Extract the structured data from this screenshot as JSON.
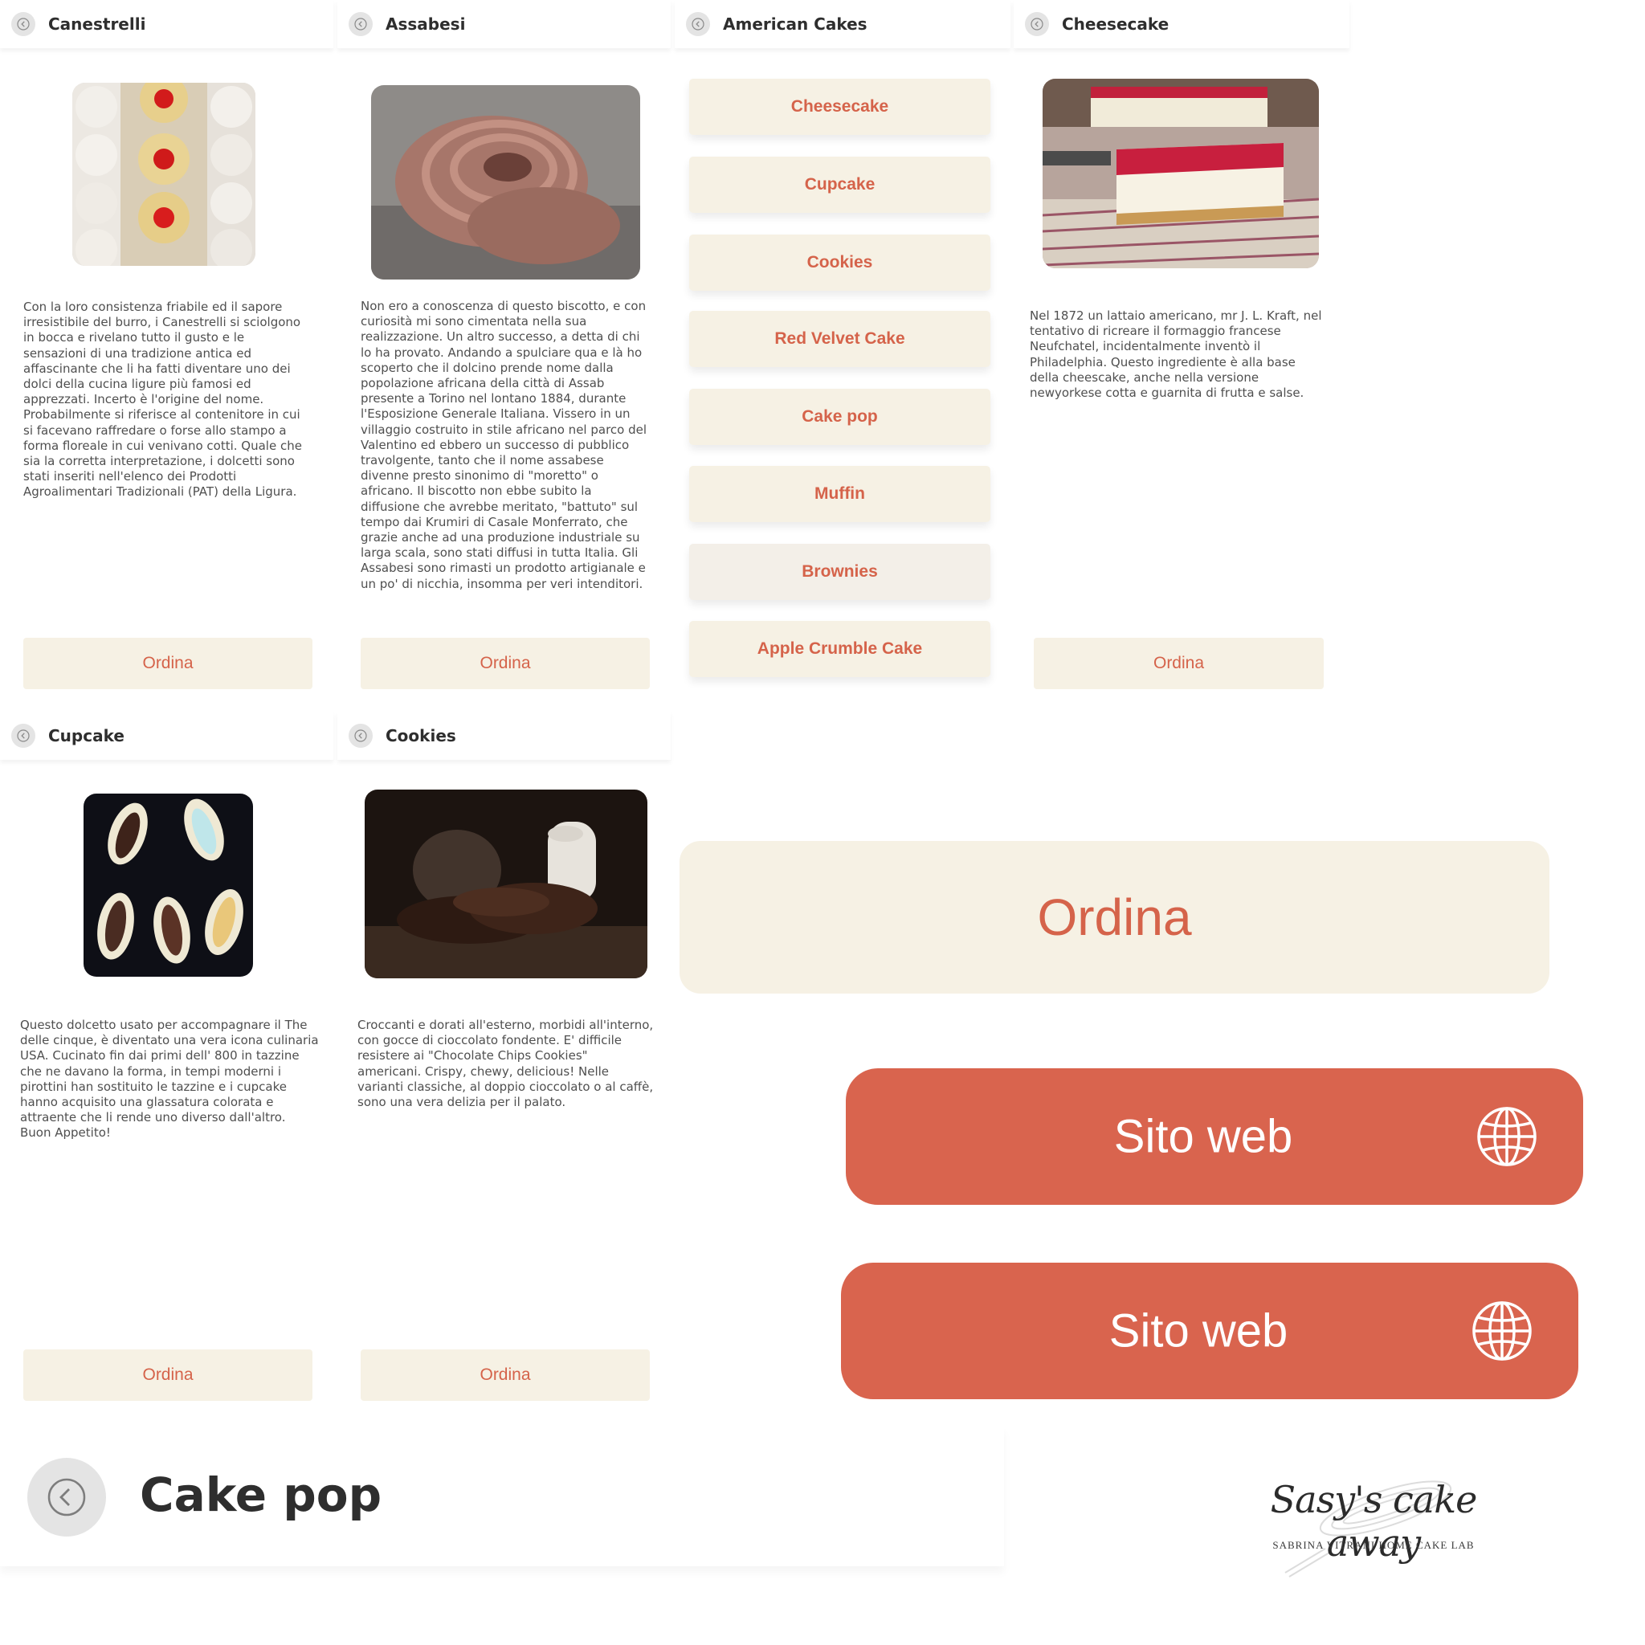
{
  "colors": {
    "accent": "#d5634a",
    "cream": "#f6f1e4",
    "web_red": "#d9644e",
    "title": "#2e2e2e",
    "text": "#4f4f4f"
  },
  "icons": {
    "back": "back-arrow-icon",
    "globe": "globe-icon"
  },
  "panels": {
    "canestrelli": {
      "title": "Canestrelli",
      "image": "canestrelli-cookies-photo",
      "description": "Con la loro consistenza friabile ed il sapore irresistibile del burro, i Canestrelli si sciolgono in bocca e rivelano tutto il gusto e le sensazioni di una tradizione antica ed affascinante che li ha fatti diventare uno dei dolci della cucina ligure più famosi ed apprezzati. Incerto è l'origine del nome. Probabilmente si riferisce al contenitore in cui si facevano raffredare o forse allo stampo a forma floreale in cui venivano cotti. Quale che sia la corretta interpretazione, i dolcetti sono stati inseriti nell'elenco dei Prodotti Agroalimentari Tradizionali (PAT) della Ligura.",
      "button": "Ordina"
    },
    "assabesi": {
      "title": "Assabesi",
      "image": "assabesi-biscuit-photo",
      "description": "Non ero a conoscenza di questo biscotto, e con curiosità mi sono cimentata nella sua realizzazione. Un altro successo, a detta di chi lo ha provato. Andando a spulciare qua e là ho scoperto che il dolcino prende nome dalla popolazione africana della città di Assab presente a Torino nel lontano 1884, durante l'Esposizione Generale Italiana. Vissero in un villaggio costruito in stile africano nel parco del Valentino ed ebbero un successo di pubblico travolgente, tanto che il nome assabese divenne presto sinonimo di \"moretto\" o africano. Il biscotto non ebbe subito la diffusione che avrebbe meritato, \"battuto\" sul tempo dai Krumiri di Casale Monferrato, che grazie anche ad una produzione industriale su larga scala, sono stati diffusi in tutta Italia. Gli Assabesi sono rimasti un prodotto artigianale e un po' di nicchia, insomma per veri intenditori.",
      "button": "Ordina"
    },
    "american": {
      "title": "American Cakes",
      "items": [
        "Cheesecake",
        "Cupcake",
        "Cookies",
        "Red Velvet Cake",
        "Cake pop",
        "Muffin",
        "Brownies",
        "Apple Crumble Cake"
      ]
    },
    "cheesecake": {
      "title": "Cheesecake",
      "image": "cheesecake-photo",
      "description": "Nel 1872 un lattaio americano, mr J. L. Kraft, nel tentativo di ricreare il formaggio francese Neufchatel, incidentalmente inventò il Philadelphia. Questo ingrediente è alla base della cheescake, anche nella versione newyorkese cotta e guarnita di frutta e salse.",
      "button": "Ordina"
    },
    "cupcake": {
      "title": "Cupcake",
      "image": "cupcake-pastries-photo",
      "description": "Questo dolcetto usato per accompagnare il The delle cinque, è diventato una vera icona culinaria USA. Cucinato fin dai primi dell' 800 in tazzine che ne davano la forma, in tempi moderni i pirottini han sostituito le tazzine e i cupcake hanno acquisito una glassatura colorata e attraente che li rende uno diverso dall'altro. Buon Appetito!",
      "button": "Ordina"
    },
    "cookies": {
      "title": "Cookies",
      "image": "chocolate-cookies-photo",
      "description": "Croccanti e dorati all'esterno, morbidi all'interno, con gocce di cioccolato fondente. E' difficile resistere ai \"Chocolate Chips Cookies\" americani. Crispy, chewy, delicious! Nelle varianti classiche, al doppio cioccolato o al caffè, sono una vera delizia per il palato.",
      "button": "Ordina"
    }
  },
  "big_order_button": "Ordina",
  "website_buttons": [
    "Sito web",
    "Sito web"
  ],
  "cakepop_header": {
    "title": "Cake pop"
  },
  "logo": {
    "name": "Sasy's cake away",
    "tagline": "SABRINA VITRANI HOME CAKE LAB"
  }
}
